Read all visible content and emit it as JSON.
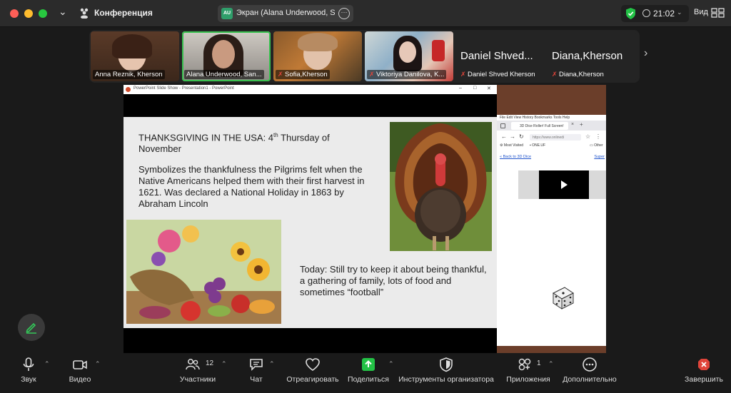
{
  "titlebar": {
    "meeting_title": "Конференция",
    "share_badge": "AU",
    "share_label": "Экран (Alana Underwood, Sa",
    "time": "21:02",
    "view_label": "Вид"
  },
  "participants": [
    {
      "name": "Anna Reznik, Kherson",
      "camera": true,
      "muted": false
    },
    {
      "name": "Alana Underwood, San...",
      "camera": true,
      "muted": false,
      "active": true
    },
    {
      "name": "Sofia,Kherson",
      "camera": true,
      "muted": true
    },
    {
      "name": "Viktoriya Danilova, K...",
      "camera": true,
      "muted": true
    },
    {
      "display": "Daniel Shved...",
      "name": "Daniel Shved Kherson",
      "camera": false,
      "muted": true
    },
    {
      "display": "Diana,Kherson",
      "name": "Diana,Kherson",
      "camera": false,
      "muted": true
    }
  ],
  "ppt": {
    "window_title": "PowerPoint Slide Show - Presentation1 - PowerPoint",
    "heading_pre": "THANKSGIVING IN THE USA: 4",
    "heading_sup": "th",
    "heading_post": " Thursday of November",
    "body": "Symbolizes the thankfulness the Pilgrims felt when the Native Americans helped them with their first harvest in 1621. Was declared a National Holiday in 1863 by Abraham Lincoln",
    "today": "Today: Still try to keep it about being thankful, a gathering of family, lots of food and sometimes “football”"
  },
  "browser": {
    "menu": "File  Edit  View  History  Bookmarks  Tools  Help",
    "tab_title": "3D Dice Roller! Full Screen!",
    "url": "https://www.onlinedi",
    "bookmark_1": "Most Visited",
    "bookmark_2": "ONE.UF",
    "bookmark_3": "Other",
    "back_link": "« Back to 3D Dice",
    "super_link": "Super"
  },
  "toolbar": {
    "audio": "Звук",
    "video": "Видео",
    "participants": "Участники",
    "participants_count": "12",
    "chat": "Чат",
    "react": "Отреагировать",
    "share": "Поделиться",
    "host_tools": "Инструменты организатора",
    "apps": "Приложения",
    "apps_count": "1",
    "more": "Дополнительно",
    "end": "Завершить"
  },
  "colors": {
    "active_speaker": "#39c14f",
    "share_green": "#23c246",
    "end_red": "#e0443a"
  }
}
